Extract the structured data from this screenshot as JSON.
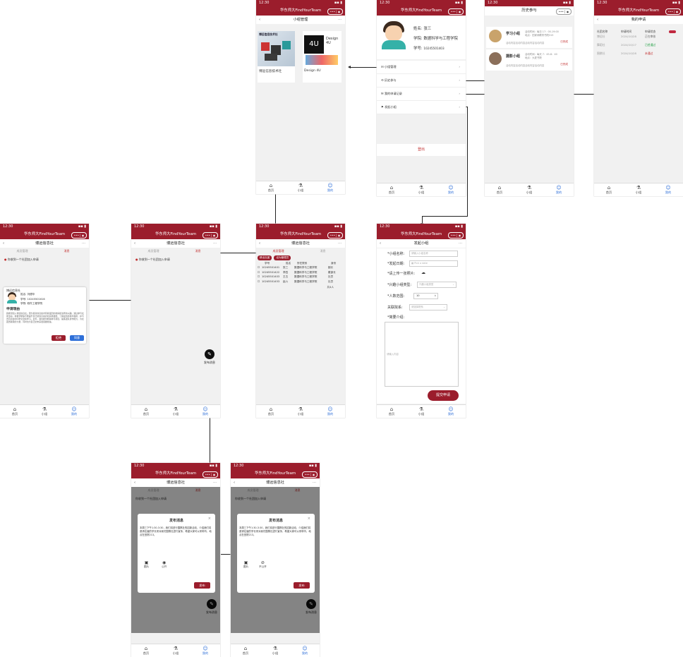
{
  "status_time": "12:30",
  "app_title": "华东师大FindYourTeam",
  "tabs": {
    "home": "首页",
    "group": "小组",
    "mine": "我的"
  },
  "phone_group_mgmt": {
    "title": "小组管理",
    "cards": [
      {
        "name": "博远信息技术社",
        "img_caption": "博远信息技术社"
      },
      {
        "name": "Design 4U",
        "img_caption": "Design 4U"
      }
    ]
  },
  "phone_profile": {
    "name_label": "姓名:",
    "name": "张三",
    "college_label": "学院:",
    "college": "数据科学与工程学院",
    "id_label": "学号:",
    "id": "10245501403",
    "menu": [
      "小组管理",
      "历史参与",
      "我的申请记录",
      "发起小组"
    ],
    "logout": "登出"
  },
  "phone_history": {
    "title": "历史参与",
    "items": [
      {
        "name": "学习小组",
        "time": "活动时间：每日 17：00-19:00",
        "place": "地点：田家炳教育书院315",
        "desc": "活动内容活动内容活动内容活动内容",
        "status": "已完成"
      },
      {
        "name": "摄影小组",
        "time": "活动时间：每天 7：45-8：40",
        "place": "地点：大夏书院",
        "desc": "活动内容活动内容活动内容活动内容",
        "status": "已完成"
      }
    ]
  },
  "phone_applications": {
    "title": "我的申请",
    "headers": [
      "社团名称",
      "申请时间",
      "申请状态"
    ],
    "rows": [
      {
        "name": "博远社",
        "date": "2024/10/28",
        "status": "正在审核",
        "status_color": "#666666"
      },
      {
        "name": "舞蹈社",
        "date": "2024/10/17",
        "status": "已经通过",
        "status_color": "#22a045"
      },
      {
        "name": "围棋社",
        "date": "2024/10/28",
        "status": "未通过",
        "status_color": "#c02c2c"
      }
    ]
  },
  "phone_msg_detail": {
    "title": "博远信息社",
    "tab_left": "成员管理",
    "tab_right": "消息",
    "notice": "你收到一个社团加入申请",
    "card_title": "博远信息社",
    "applicant_name_label": "姓名:",
    "applicant_name": "刘德华",
    "applicant_id_label": "学号:",
    "applicant_id": "10245501616",
    "applicant_college_label": "学院:",
    "applicant_college": "软件工程学院",
    "reason_title": "申请理由",
    "reason_text": "我希望加入博远信息社。因为我对信息技术有着强烈的热情和浓厚的兴趣。通过参与社团活动，我希望能够不断提升自己的信息素养和实践技能，了解最新的技术趋势，并与志同道合的同学交流和学习。此外，我也希望能够参与项目，锻炼团队协作能力，为社团贡献我的力量，同时也为自己的未来发展做准备。",
    "reject": "拒绝",
    "approve": "同意"
  },
  "phone_msg_list": {
    "title": "博远信息社",
    "tab_left": "成员管理",
    "tab_right": "消息",
    "notice": "你收到一个社团加入申请",
    "fab_label": "发布消息"
  },
  "phone_members": {
    "title": "博远信息社",
    "tab_left": "成员管理",
    "tab_right": "消息",
    "btn_remove": "移出社团",
    "btn_admin": "设为管理员",
    "headers": [
      "学号",
      "姓名",
      "所在院系",
      "身份"
    ],
    "rows": [
      {
        "id": "10245501401",
        "name": "张三",
        "dept": "数据科学与工程学院",
        "role": "副长"
      },
      {
        "id": "10245501422",
        "name": "李四",
        "dept": "数据科学与工程学院",
        "role": "戴部长"
      },
      {
        "id": "10245501403",
        "name": "王五",
        "dept": "数据科学与工程学院",
        "role": "社员"
      },
      {
        "id": "10245501453",
        "name": "赵六",
        "dept": "数据科学与工程学院",
        "role": "社员"
      }
    ],
    "total": "共4人"
  },
  "phone_create": {
    "title": "发起小组",
    "name_label": "*小组名称:",
    "name_ph": "请输入小组名称",
    "date_label": "*发起日期:",
    "date_ph": "Pick a date",
    "photo_label": "*请上传一张照片:",
    "type_label": "*兴趣小组类型:",
    "type_ph": "兴趣小组类型",
    "size_label": "*人数范围:",
    "size_val": "10",
    "dept_label": "关联院系:",
    "dept_ph": "请选择院系",
    "intro_label": "*简要介绍:",
    "intro_ph": "请输入内容",
    "submit": "提交申请"
  },
  "phone_post_a": {
    "title": "博远信息社",
    "tab_left": "成员管理",
    "tab_right": "消息",
    "notice": "你收到一个社团加入申请",
    "modal_title": "发布消息",
    "modal_text": "本周三下午1:30-3:30，我们将进行围棋社的招新活动，介绍我们将邀请往届的学长来对我们围棋社进行宣传，希望大家可以来听听，地点在田院213。",
    "icon1": "图片",
    "icon2": "公开",
    "publish": "发布",
    "fab_label": "发布消息"
  },
  "phone_post_b": {
    "title": "博远信息社",
    "tab_left": "成员管理",
    "tab_right": "消息",
    "notice": "你收到一个社团加入申请",
    "modal_title": "发布消息",
    "modal_text": "本周三下午1:30-3:30，我们将进行围棋社的招新活动，介绍我们将邀请往届的学长来对我们围棋社进行宣传，希望大家可以来听听，地点在田院213。",
    "icon1": "图片",
    "icon2": "不公开",
    "publish": "发布",
    "fab_label": "发布消息"
  }
}
